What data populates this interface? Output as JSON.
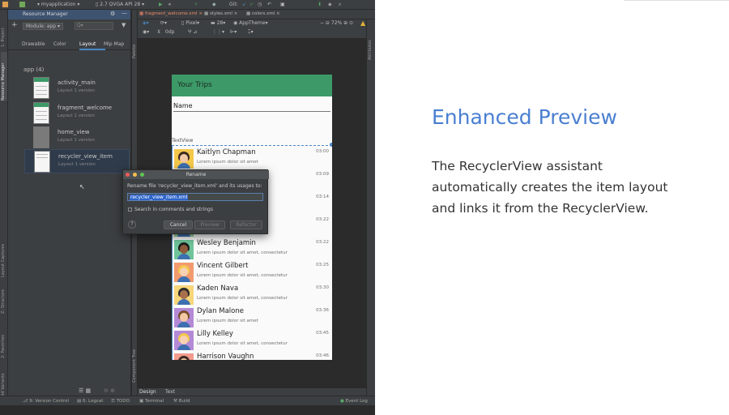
{
  "ide": {
    "toolbar": {
      "config": "myapplication",
      "device": "2.7 QVGA API 28",
      "git_label": "Git:"
    },
    "resource_manager": {
      "title": "Resource Manager",
      "module_label": "Module: app",
      "tabs": [
        "Drawable",
        "Color",
        "Layout",
        "Mip Map"
      ],
      "active_tab": "Layout",
      "group_title": "app (4)",
      "items": [
        {
          "name": "activity_main",
          "sub": "Layout   1 version"
        },
        {
          "name": "fragment_welcome",
          "sub": "Layout   1 version"
        },
        {
          "name": "home_view",
          "sub": "Layout   1 version"
        },
        {
          "name": "recycler_view_item",
          "sub": "Layout   1 version"
        }
      ]
    },
    "editor_tabs": [
      "fragment_welcome.xml",
      "styles.xml",
      "colors.xml"
    ],
    "editor_toolbar": {
      "device": "Pixel",
      "api": "28",
      "theme": "AppTheme",
      "zoom": "72%",
      "margin": "0dp"
    },
    "left_strip_labels": [
      "1: Project",
      "Resource Manager",
      "Layout Captures",
      "Z: Structure",
      "2: Favorites",
      "Build Variants"
    ],
    "palette_labels": [
      "Palette",
      "Component Tree"
    ],
    "right_strip_label": "Attributes",
    "design_tabs": [
      "Design",
      "Text"
    ],
    "status": {
      "items": [
        "9: Version Control",
        "6: Logcat",
        "TODO",
        "Terminal",
        "Build"
      ],
      "event_log": "Event Log"
    }
  },
  "phone": {
    "title": "Your Trips",
    "name_label": "Name",
    "textview_label": "TextView",
    "rows": [
      {
        "name": "Kaitlyn Chapman",
        "sub": "Lorem ipsum dolor sit amet",
        "time": "03:00",
        "color": "#f4c84a",
        "hair": "#3b2a1f",
        "skin": "#f1c9a5"
      },
      {
        "name": "",
        "sub": "consectetur",
        "time": "03:09",
        "color": "#7fc6e0",
        "hair": "#a04b2e",
        "skin": "#f0c4a0"
      },
      {
        "name": "",
        "sub": "consectetur",
        "time": "03:14",
        "color": "#f29a8e",
        "hair": "#222222",
        "skin": "#d49c78"
      },
      {
        "name": "",
        "sub": "consectetur",
        "time": "03:22",
        "color": "#9bd49b",
        "hair": "#4a3222",
        "skin": "#c98d68"
      },
      {
        "name": "Wesley Benjamin",
        "sub": "Lorem ipsum dolor sit amet, consectetur",
        "time": "03:22",
        "color": "#6fc49a",
        "hair": "#1e1e1e",
        "skin": "#8d5a3b"
      },
      {
        "name": "Vincent Gilbert",
        "sub": "Lorem ipsum dolor sit amet, consectetur",
        "time": "03:25",
        "color": "#f29a6e",
        "hair": "#f4c84a",
        "skin": "#f6d1b3"
      },
      {
        "name": "Kaden Nava",
        "sub": "Lorem ipsum dolor sit amet, consectetur",
        "time": "03:30",
        "color": "#f7d67a",
        "hair": "#2a2a2a",
        "skin": "#a86f4c"
      },
      {
        "name": "Dylan Malone",
        "sub": "Lorem ipsum dolor sit amet",
        "time": "03:36",
        "color": "#b48ad6",
        "hair": "#7a4e2e",
        "skin": "#f1c9a5"
      },
      {
        "name": "Lilly Kelley",
        "sub": "Lorem ipsum dolor sit amet, consectetur",
        "time": "03:45",
        "color": "#b48ad6",
        "hair": "#f4c84a",
        "skin": "#f6d1b3"
      },
      {
        "name": "Harrison Vaughn",
        "sub": "",
        "time": "03:46",
        "color": "#f29a8e",
        "hair": "#3b2a1f",
        "skin": "#f0c4a0"
      }
    ]
  },
  "dialog": {
    "title": "Rename",
    "message": "Rename file 'recycler_view_item.xml' and its usages to:",
    "input_value": "recycler_view_item.xml",
    "checkbox_label": "Search in comments and strings",
    "help": "?",
    "cancel": "Cancel",
    "preview": "Preview",
    "refactor": "Refactor"
  },
  "slide": {
    "title": "Enhanced Preview",
    "body": "The RecyclerView assistant automatically creates the item layout and links it from the RecyclerView."
  },
  "colors": {
    "accent": "#4a7fd1",
    "app_bar": "#3d9a68",
    "ide_bg": "#2b2b2b",
    "selection": "#2f65ca"
  }
}
